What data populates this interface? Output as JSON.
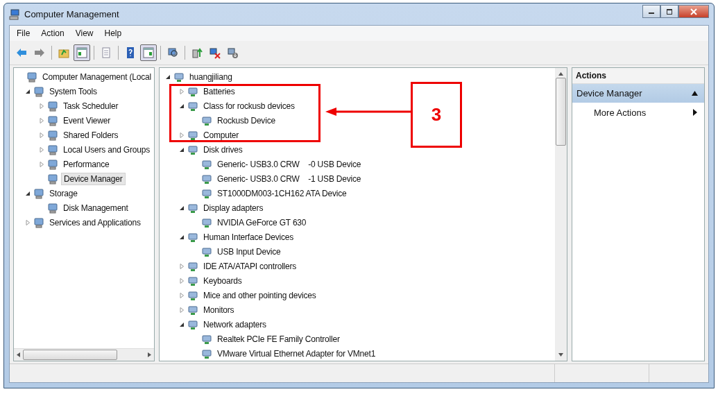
{
  "window": {
    "title": "Computer Management"
  },
  "menu": [
    "File",
    "Action",
    "View",
    "Help"
  ],
  "toolbar": [
    {
      "pressed": false
    },
    {
      "pressed": false
    },
    {
      "pressed": false
    },
    {
      "pressed": true
    },
    {
      "pressed": false
    },
    {
      "pressed": false
    },
    {
      "pressed": true
    },
    {
      "pressed": false
    },
    {
      "pressed": false
    },
    {
      "pressed": false
    },
    {
      "pressed": false
    }
  ],
  "nav_tree": {
    "label": "Computer Management (Local",
    "selected": false,
    "children": [
      {
        "label": "System Tools",
        "selected": false,
        "expanded": true,
        "children": [
          {
            "label": "Task Scheduler",
            "selected": false,
            "expanded": false
          },
          {
            "label": "Event Viewer",
            "selected": false,
            "expanded": false
          },
          {
            "label": "Shared Folders",
            "selected": false,
            "expanded": false
          },
          {
            "label": "Local Users and Groups",
            "selected": false,
            "expanded": false
          },
          {
            "label": "Performance",
            "selected": false,
            "expanded": false
          },
          {
            "label": "Device Manager",
            "selected": true
          }
        ]
      },
      {
        "label": "Storage",
        "selected": false,
        "expanded": true,
        "children": [
          {
            "label": "Disk Management",
            "selected": false
          }
        ]
      },
      {
        "label": "Services and Applications",
        "selected": false,
        "expanded": false
      }
    ]
  },
  "device_tree": {
    "label": "huangjiliang",
    "expanded": true,
    "children": [
      {
        "label": "Batteries",
        "expanded": false
      },
      {
        "label": "Class for rockusb devices",
        "expanded": true,
        "children": [
          {
            "label": "Rockusb Device"
          }
        ]
      },
      {
        "label": "Computer",
        "expanded": false
      },
      {
        "label": "Disk drives",
        "expanded": true,
        "children": [
          {
            "label": "Generic- USB3.0 CRW    -0 USB Device"
          },
          {
            "label": "Generic- USB3.0 CRW    -1 USB Device"
          },
          {
            "label": "ST1000DM003-1CH162 ATA Device"
          }
        ]
      },
      {
        "label": "Display adapters",
        "expanded": true,
        "children": [
          {
            "label": "NVIDIA GeForce GT 630"
          }
        ]
      },
      {
        "label": "Human Interface Devices",
        "expanded": true,
        "children": [
          {
            "label": "USB Input Device"
          }
        ]
      },
      {
        "label": "IDE ATA/ATAPI controllers",
        "expanded": false
      },
      {
        "label": "Keyboards",
        "expanded": false
      },
      {
        "label": "Mice and other pointing devices",
        "expanded": false
      },
      {
        "label": "Monitors",
        "expanded": false
      },
      {
        "label": "Network adapters",
        "expanded": true,
        "children": [
          {
            "label": "Realtek PCIe FE Family Controller"
          },
          {
            "label": "VMware Virtual Ethernet Adapter for VMnet1"
          }
        ]
      }
    ]
  },
  "actions": {
    "title": "Actions",
    "sections": [
      {
        "label": "Device Manager",
        "expanded": true,
        "items": [
          "More Actions"
        ]
      }
    ]
  },
  "annotation": {
    "label": "3"
  }
}
